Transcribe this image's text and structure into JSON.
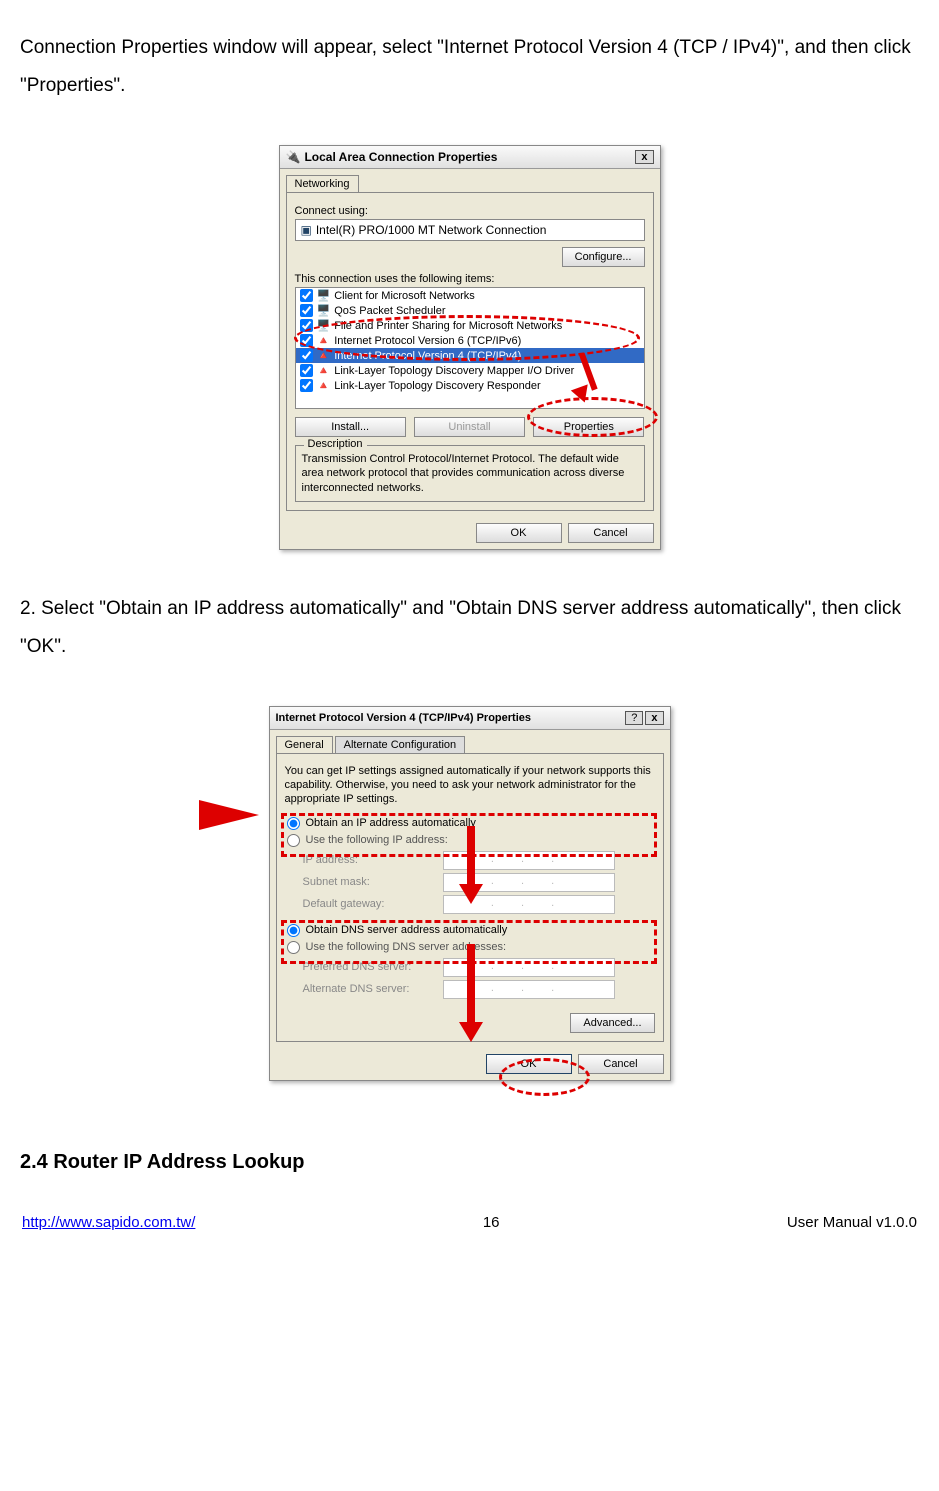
{
  "intro_line": "Connection Properties window will appear, select \"Internet Protocol Version 4 (TCP / IPv4)\", and then click \"Properties\".",
  "dialog1": {
    "title": "Local Area Connection Properties",
    "close": "x",
    "tab": "Networking",
    "connect_using_label": "Connect using:",
    "adapter": "Intel(R) PRO/1000 MT Network Connection",
    "configure": "Configure...",
    "items_label": "This connection uses the following items:",
    "items": [
      "Client for Microsoft Networks",
      "QoS Packet Scheduler",
      "File and Printer Sharing for Microsoft Networks",
      "Internet Protocol Version 6 (TCP/IPv6)",
      "Internet Protocol Version 4 (TCP/IPv4)",
      "Link-Layer Topology Discovery Mapper I/O Driver",
      "Link-Layer Topology Discovery Responder"
    ],
    "install": "Install...",
    "uninstall": "Uninstall",
    "properties": "Properties",
    "desc_label": "Description",
    "description": "Transmission Control Protocol/Internet Protocol. The default wide area network protocol that provides communication across diverse interconnected networks.",
    "ok": "OK",
    "cancel": "Cancel"
  },
  "step2": "2.    Select \"Obtain an IP address automatically\" and \"Obtain DNS server address automatically\", then click \"OK\".",
  "dialog2": {
    "title": "Internet Protocol Version 4 (TCP/IPv4) Properties",
    "help": "?",
    "close": "x",
    "tab_general": "General",
    "tab_alt": "Alternate Configuration",
    "intro": "You can get IP settings assigned automatically if your network supports this capability. Otherwise, you need to ask your network administrator for the appropriate IP settings.",
    "opt_ip_auto": "Obtain an IP address automatically",
    "opt_ip_manual": "Use the following IP address:",
    "ip_address": "IP address:",
    "subnet": "Subnet mask:",
    "gateway": "Default gateway:",
    "opt_dns_auto": "Obtain DNS server address automatically",
    "opt_dns_manual": "Use the following DNS server addresses:",
    "pref_dns": "Preferred DNS server:",
    "alt_dns": "Alternate DNS server:",
    "advanced": "Advanced...",
    "ok": "OK",
    "cancel": "Cancel"
  },
  "section_head": "2.4    Router IP Address Lookup",
  "footer": {
    "url": "http://www.sapido.com.tw/",
    "page": "16",
    "version": "User Manual v1.0.0"
  }
}
